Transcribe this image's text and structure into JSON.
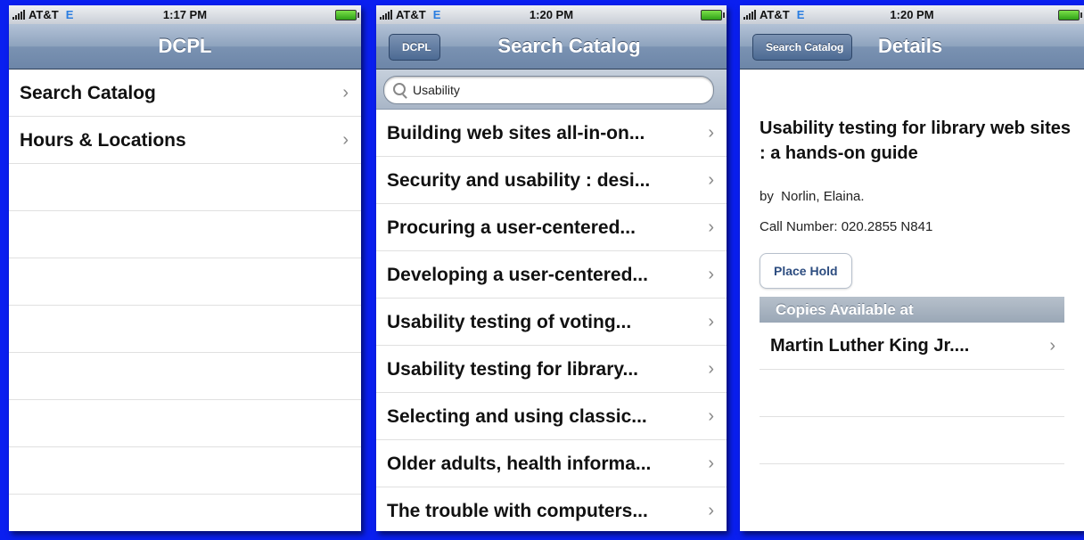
{
  "screens": [
    {
      "status": {
        "carrier": "AT&T",
        "network": "E",
        "time": "1:17 PM"
      },
      "nav": {
        "title": "DCPL"
      },
      "items": [
        {
          "label": "Search Catalog"
        },
        {
          "label": "Hours & Locations"
        }
      ]
    },
    {
      "status": {
        "carrier": "AT&T",
        "network": "E",
        "time": "1:20 PM"
      },
      "nav": {
        "back": "DCPL",
        "title": "Search Catalog"
      },
      "search": {
        "value": "Usability"
      },
      "results": [
        {
          "label": "Building web sites all-in-on..."
        },
        {
          "label": "Security and usability : desi..."
        },
        {
          "label": "Procuring a user-centered..."
        },
        {
          "label": "Developing a user-centered..."
        },
        {
          "label": "Usability testing of voting..."
        },
        {
          "label": "Usability testing for library..."
        },
        {
          "label": "Selecting and using classic..."
        },
        {
          "label": "Older adults, health informa..."
        },
        {
          "label": "The trouble with computers..."
        }
      ]
    },
    {
      "status": {
        "carrier": "AT&T",
        "network": "E",
        "time": "1:20 PM"
      },
      "nav": {
        "back": "Search Catalog",
        "title": "Details"
      },
      "book": {
        "title": "Usability testing for library web sites : a hands-on guide",
        "author": "by  Norlin, Elaina.",
        "call_number": "Call Number: 020.2855 N841"
      },
      "place_hold": "Place Hold",
      "copies_header": "Copies Available at",
      "copies": [
        {
          "label": "Martin Luther King Jr...."
        }
      ]
    }
  ],
  "chevron": "›",
  "colors": {
    "background": "#0a1ff0",
    "navbar": "#7a92b2"
  }
}
